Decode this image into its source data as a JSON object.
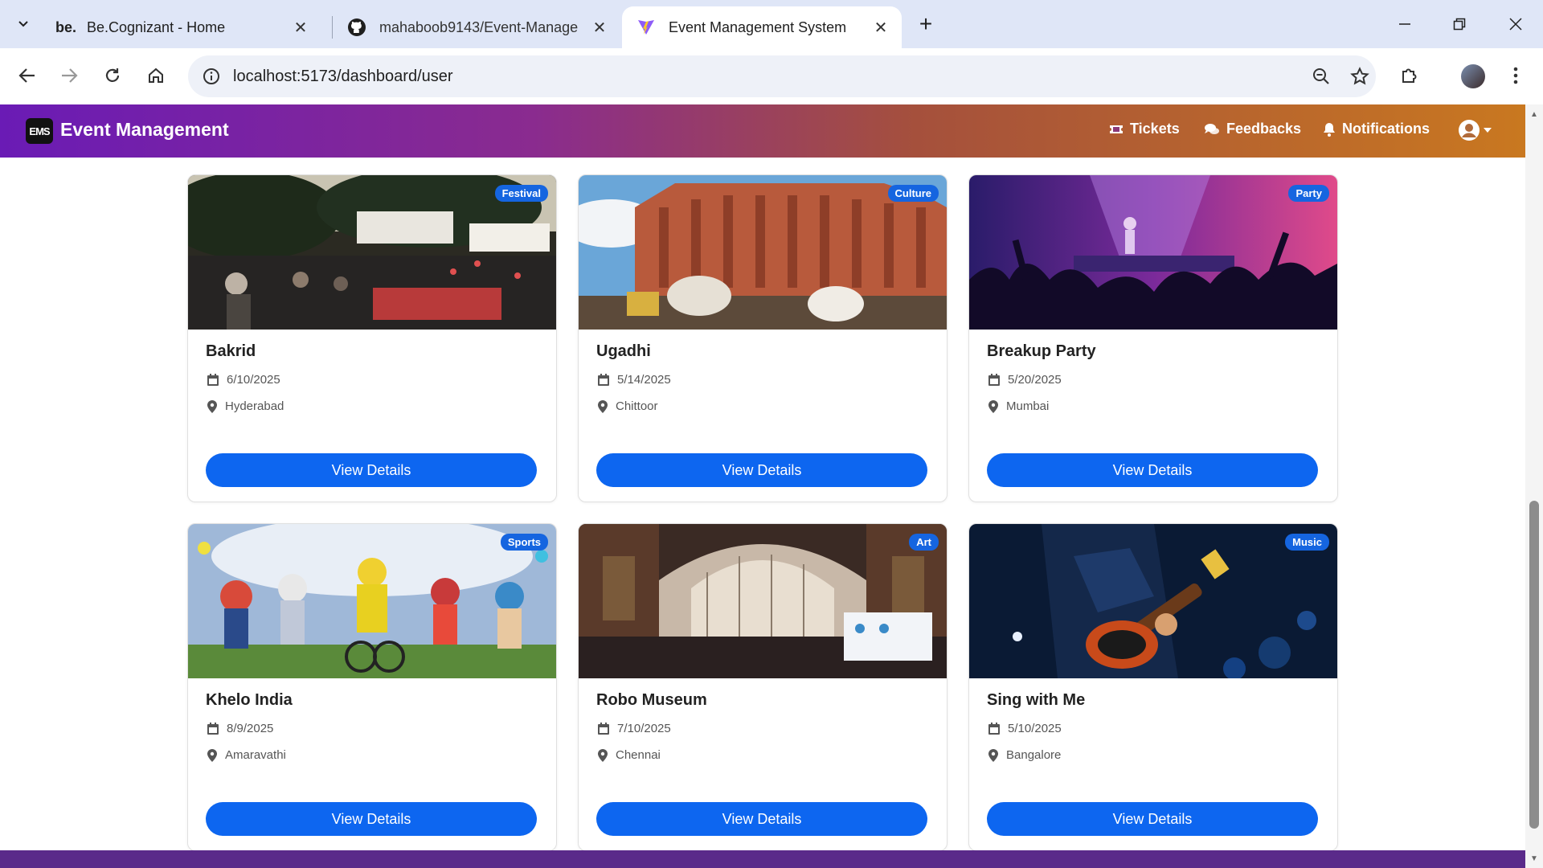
{
  "browser": {
    "tabs": [
      {
        "favicon": "be.",
        "title": "Be.Cognizant - Home"
      },
      {
        "favicon": "github-icon",
        "title": "mahaboob9143/Event-Manage"
      },
      {
        "favicon": "vite-icon",
        "title": "Event Management System"
      }
    ],
    "url": "localhost:5173/dashboard/user"
  },
  "app": {
    "logo_text": "EMS",
    "brand": "Event Management",
    "nav": {
      "tickets": "Tickets",
      "feedbacks": "Feedbacks",
      "notifications": "Notifications"
    }
  },
  "events": [
    {
      "title": "Bakrid",
      "badge": "Festival",
      "date": "6/10/2025",
      "location": "Hyderabad",
      "button": "View Details"
    },
    {
      "title": "Ugadhi",
      "badge": "Culture",
      "date": "5/14/2025",
      "location": "Chittoor",
      "button": "View Details"
    },
    {
      "title": "Breakup Party",
      "badge": "Party",
      "date": "5/20/2025",
      "location": "Mumbai",
      "button": "View Details"
    },
    {
      "title": "Khelo India",
      "badge": "Sports",
      "date": "8/9/2025",
      "location": "Amaravathi",
      "button": "View Details"
    },
    {
      "title": "Robo Museum",
      "badge": "Art",
      "date": "7/10/2025",
      "location": "Chennai",
      "button": "View Details"
    },
    {
      "title": "Sing with Me",
      "badge": "Music",
      "date": "5/10/2025",
      "location": "Bangalore",
      "button": "View Details"
    }
  ],
  "colors": {
    "accent": "#0d66f0",
    "badge": "#1565e0",
    "navbar_start": "#6a1bb5",
    "navbar_end": "#c97820"
  }
}
